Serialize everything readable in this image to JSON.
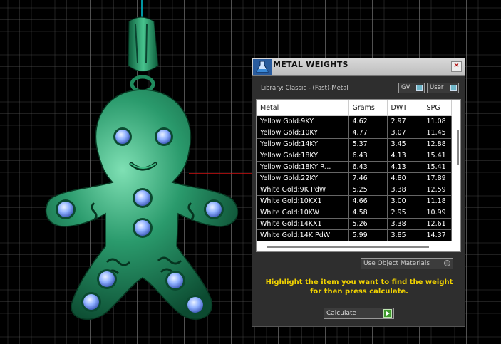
{
  "panel": {
    "title": "METAL WEIGHTS",
    "close_label": "✕",
    "library_label": "Library: Classic - (Fast)-Metal",
    "gv_label": "GV",
    "user_label": "User",
    "use_object_materials_label": "Use Object Materials",
    "hint": "Highlight the item you want to find the weight for then press calculate.",
    "calculate_label": "Calculate"
  },
  "table": {
    "headers": [
      "Metal",
      "Grams",
      "DWT",
      "SPG"
    ],
    "rows": [
      [
        "Yellow Gold:9KY",
        "4.62",
        "2.97",
        "11.08"
      ],
      [
        "Yellow Gold:10KY",
        "4.77",
        "3.07",
        "11.45"
      ],
      [
        "Yellow Gold:14KY",
        "5.37",
        "3.45",
        "12.88"
      ],
      [
        "Yellow Gold:18KY",
        "6.43",
        "4.13",
        "15.41"
      ],
      [
        "Yellow Gold:18KY R...",
        "6.43",
        "4.13",
        "15.41"
      ],
      [
        "Yellow Gold:22KY",
        "7.46",
        "4.80",
        "17.89"
      ],
      [
        "White Gold:9K PdW",
        "5.25",
        "3.38",
        "12.59"
      ],
      [
        "White Gold:10KX1",
        "4.66",
        "3.00",
        "11.18"
      ],
      [
        "White Gold:10KW",
        "4.58",
        "2.95",
        "10.99"
      ],
      [
        "White Gold:14KX1",
        "5.26",
        "3.38",
        "12.61"
      ],
      [
        "White Gold:14K PdW",
        "5.99",
        "3.85",
        "14.37"
      ]
    ]
  },
  "colors": {
    "model_green": "#2a9a6c",
    "gem_blue": "#8fb0ff",
    "hint_yellow": "#f2d300",
    "axis_cyan": "#00c8d8",
    "axis_red": "#d01010"
  },
  "icons": {
    "app_logo": "flask-icon",
    "close": "close-icon",
    "calculate": "play-icon"
  }
}
